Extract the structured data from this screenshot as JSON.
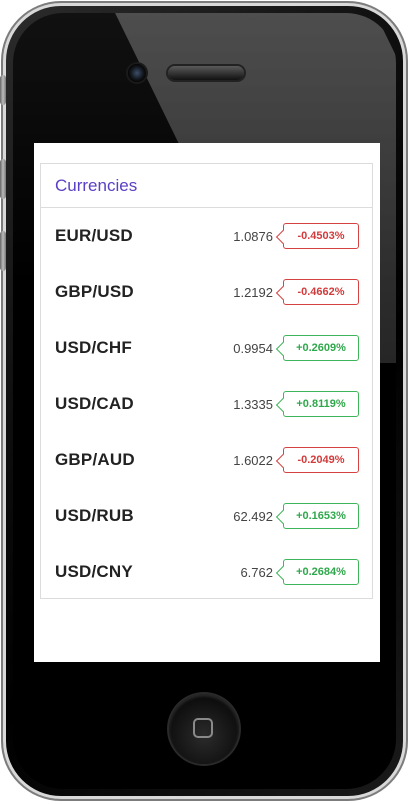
{
  "widget": {
    "title": "Currencies"
  },
  "currencies": [
    {
      "pair": "EUR/USD",
      "price": "1.0876",
      "change": "-0.4503%",
      "direction": "down"
    },
    {
      "pair": "GBP/USD",
      "price": "1.2192",
      "change": "-0.4662%",
      "direction": "down"
    },
    {
      "pair": "USD/CHF",
      "price": "0.9954",
      "change": "+0.2609%",
      "direction": "up"
    },
    {
      "pair": "USD/CAD",
      "price": "1.3335",
      "change": "+0.8119%",
      "direction": "up"
    },
    {
      "pair": "GBP/AUD",
      "price": "1.6022",
      "change": "-0.2049%",
      "direction": "down"
    },
    {
      "pair": "USD/RUB",
      "price": "62.492",
      "change": "+0.1653%",
      "direction": "up"
    },
    {
      "pair": "USD/CNY",
      "price": "6.762",
      "change": "+0.2684%",
      "direction": "up"
    }
  ],
  "colors": {
    "title_accent": "#5b3fc4",
    "negative": "#d23b3b",
    "positive": "#2fa84b"
  },
  "icons": {
    "camera": "camera-icon",
    "speaker": "speaker-icon",
    "home": "home-square-icon"
  }
}
